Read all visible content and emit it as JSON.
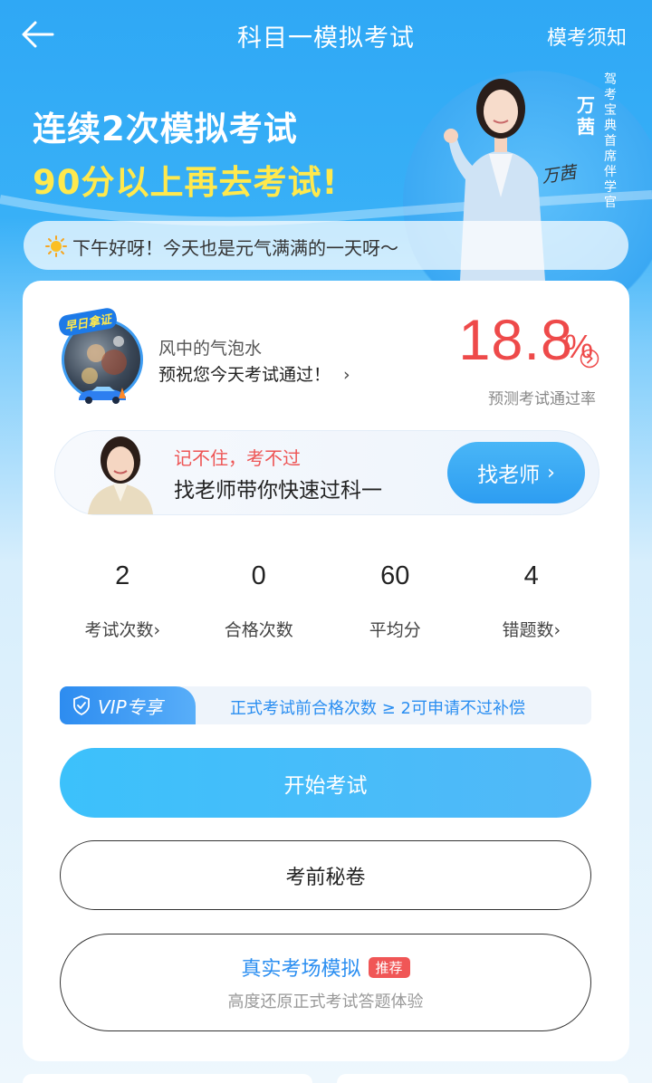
{
  "header": {
    "title": "科目一模拟考试",
    "notice": "模考须知"
  },
  "hero": {
    "line1": "连续2次模拟考试",
    "line2": "90分以上再去考试!",
    "instructor_name": "万茜",
    "instructor_role": "驾考宝典首席伴学官",
    "signature": "万茜"
  },
  "greeting": "下午好呀！今天也是元气满满的一天呀～",
  "profile": {
    "badge": "早日拿证",
    "username": "风中的气泡水",
    "wish": "预祝您今天考试通过！",
    "pass_rate": "18.8",
    "pass_rate_unit": "%",
    "pass_rate_label": "预测考试通过率"
  },
  "teacher": {
    "slogan": "记不住，考不过",
    "desc": "找老师带你快速过科一",
    "button": "找老师"
  },
  "stats": [
    {
      "value": "2",
      "label": "考试次数"
    },
    {
      "value": "0",
      "label": "合格次数"
    },
    {
      "value": "60",
      "label": "平均分"
    },
    {
      "value": "4",
      "label": "错题数"
    }
  ],
  "vip": {
    "tag": "VIP专享",
    "text": "正式考试前合格次数 ≥ 2可申请不过补偿"
  },
  "buttons": {
    "start": "开始考试",
    "secret": "考前秘卷",
    "real_exam_title": "真实考场模拟",
    "real_exam_badge": "推荐",
    "real_exam_sub": "高度还原正式考试答题体验"
  },
  "colors": {
    "primary_blue": "#2d9df1",
    "accent_red": "#ee4a4a",
    "highlight_yellow": "#ffe94d"
  }
}
